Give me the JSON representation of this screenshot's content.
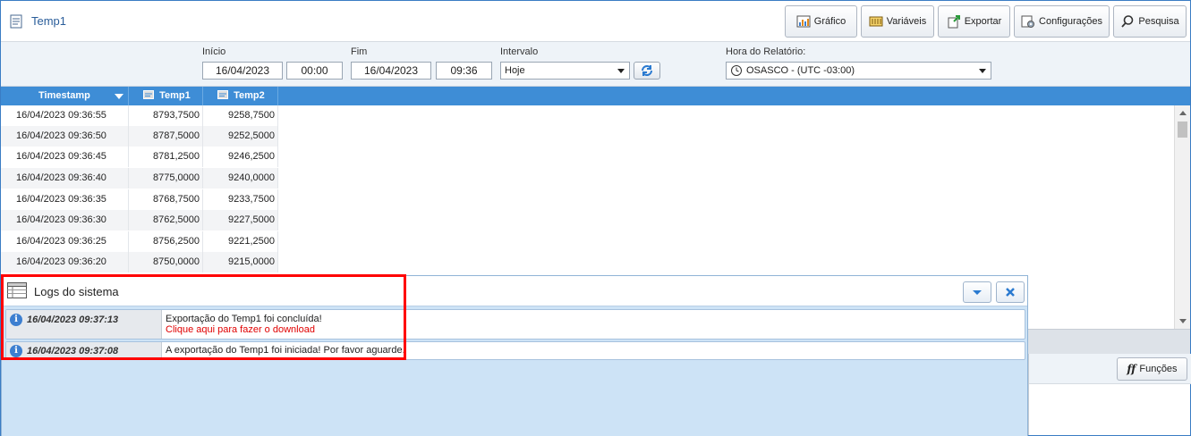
{
  "header": {
    "title": "Temp1",
    "buttons": [
      {
        "label": "Gráfico",
        "icon": "chart-icon"
      },
      {
        "label": "Variáveis",
        "icon": "variables-icon"
      },
      {
        "label": "Exportar",
        "icon": "export-icon"
      },
      {
        "label": "Configurações",
        "icon": "settings-icon"
      },
      {
        "label": "Pesquisa",
        "icon": "search-icon"
      }
    ]
  },
  "filters": {
    "inicio_label": "Início",
    "inicio_date": "16/04/2023",
    "inicio_time": "00:00",
    "fim_label": "Fim",
    "fim_date": "16/04/2023",
    "fim_time": "09:36",
    "intervalo_label": "Intervalo",
    "intervalo_value": "Hoje",
    "hora_label": "Hora do Relatório:",
    "hora_value": "OSASCO - (UTC -03:00)"
  },
  "grid": {
    "columns": [
      "Timestamp",
      "Temp1",
      "Temp2"
    ],
    "rows": [
      {
        "ts": "16/04/2023 09:36:55",
        "t1": "8793,7500",
        "t2": "9258,7500"
      },
      {
        "ts": "16/04/2023 09:36:50",
        "t1": "8787,5000",
        "t2": "9252,5000"
      },
      {
        "ts": "16/04/2023 09:36:45",
        "t1": "8781,2500",
        "t2": "9246,2500"
      },
      {
        "ts": "16/04/2023 09:36:40",
        "t1": "8775,0000",
        "t2": "9240,0000"
      },
      {
        "ts": "16/04/2023 09:36:35",
        "t1": "8768,7500",
        "t2": "9233,7500"
      },
      {
        "ts": "16/04/2023 09:36:30",
        "t1": "8762,5000",
        "t2": "9227,5000"
      },
      {
        "ts": "16/04/2023 09:36:25",
        "t1": "8756,2500",
        "t2": "9221,2500"
      },
      {
        "ts": "16/04/2023 09:36:20",
        "t1": "8750,0000",
        "t2": "9215,0000"
      }
    ]
  },
  "functions": {
    "label": "Funções"
  },
  "logs": {
    "title": "Logs do sistema",
    "entries": [
      {
        "time": "16/04/2023 09:37:13",
        "message": "Exportação do Temp1 foi concluída!",
        "link": "Clique aqui para fazer o download"
      },
      {
        "time": "16/04/2023 09:37:08",
        "message": "A exportação do Temp1 foi iniciada! Por favor aguarde."
      }
    ]
  },
  "colors": {
    "accent": "#3e8dd6",
    "highlight": "#ff0000",
    "link": "#e00000"
  }
}
